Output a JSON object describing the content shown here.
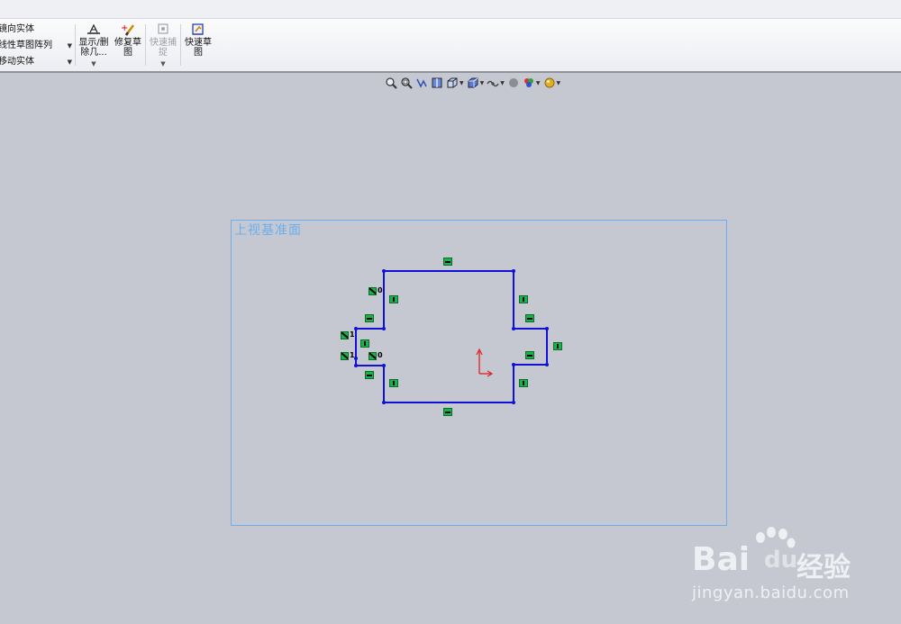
{
  "ribbon": {
    "list_items": [
      {
        "label": "镜向实体",
        "has_dropdown": false
      },
      {
        "label": "线性草图阵列",
        "has_dropdown": true
      },
      {
        "label": "移动实体",
        "has_dropdown": true
      }
    ],
    "buttons": [
      {
        "line1": "显示/删",
        "line2": "除几...",
        "has_dropdown": true,
        "disabled": false
      },
      {
        "line1": "修复草",
        "line2": "图",
        "has_dropdown": false,
        "disabled": false
      },
      {
        "line1": "快速捕",
        "line2": "捉",
        "has_dropdown": true,
        "disabled": true
      },
      {
        "line1": "快速草",
        "line2": "图",
        "has_dropdown": false,
        "disabled": false
      }
    ]
  },
  "view_toolbar": {
    "icons": [
      "zoom-to-fit-icon",
      "zoom-to-area-icon",
      "previous-view-icon",
      "section-view-icon",
      "view-orientation-icon",
      "display-style-icon",
      "hide-show-items-icon",
      "edit-appearance-icon",
      "apply-scene-icon",
      "view-settings-icon"
    ]
  },
  "plane": {
    "label": "上视基准面"
  },
  "relations": {
    "coincident_labels": [
      "0",
      "1",
      "1",
      "0"
    ]
  },
  "watermark": {
    "brand_left": "Bai",
    "brand_right": "du",
    "brand_cn": "经验",
    "url": "jingyan.baidu.com"
  },
  "colors": {
    "sketch_line": "#1010d8",
    "relation_green": "#19b34a",
    "plane_border": "#6aaef0",
    "background": "#c5c8d1",
    "origin": "#e02020"
  }
}
